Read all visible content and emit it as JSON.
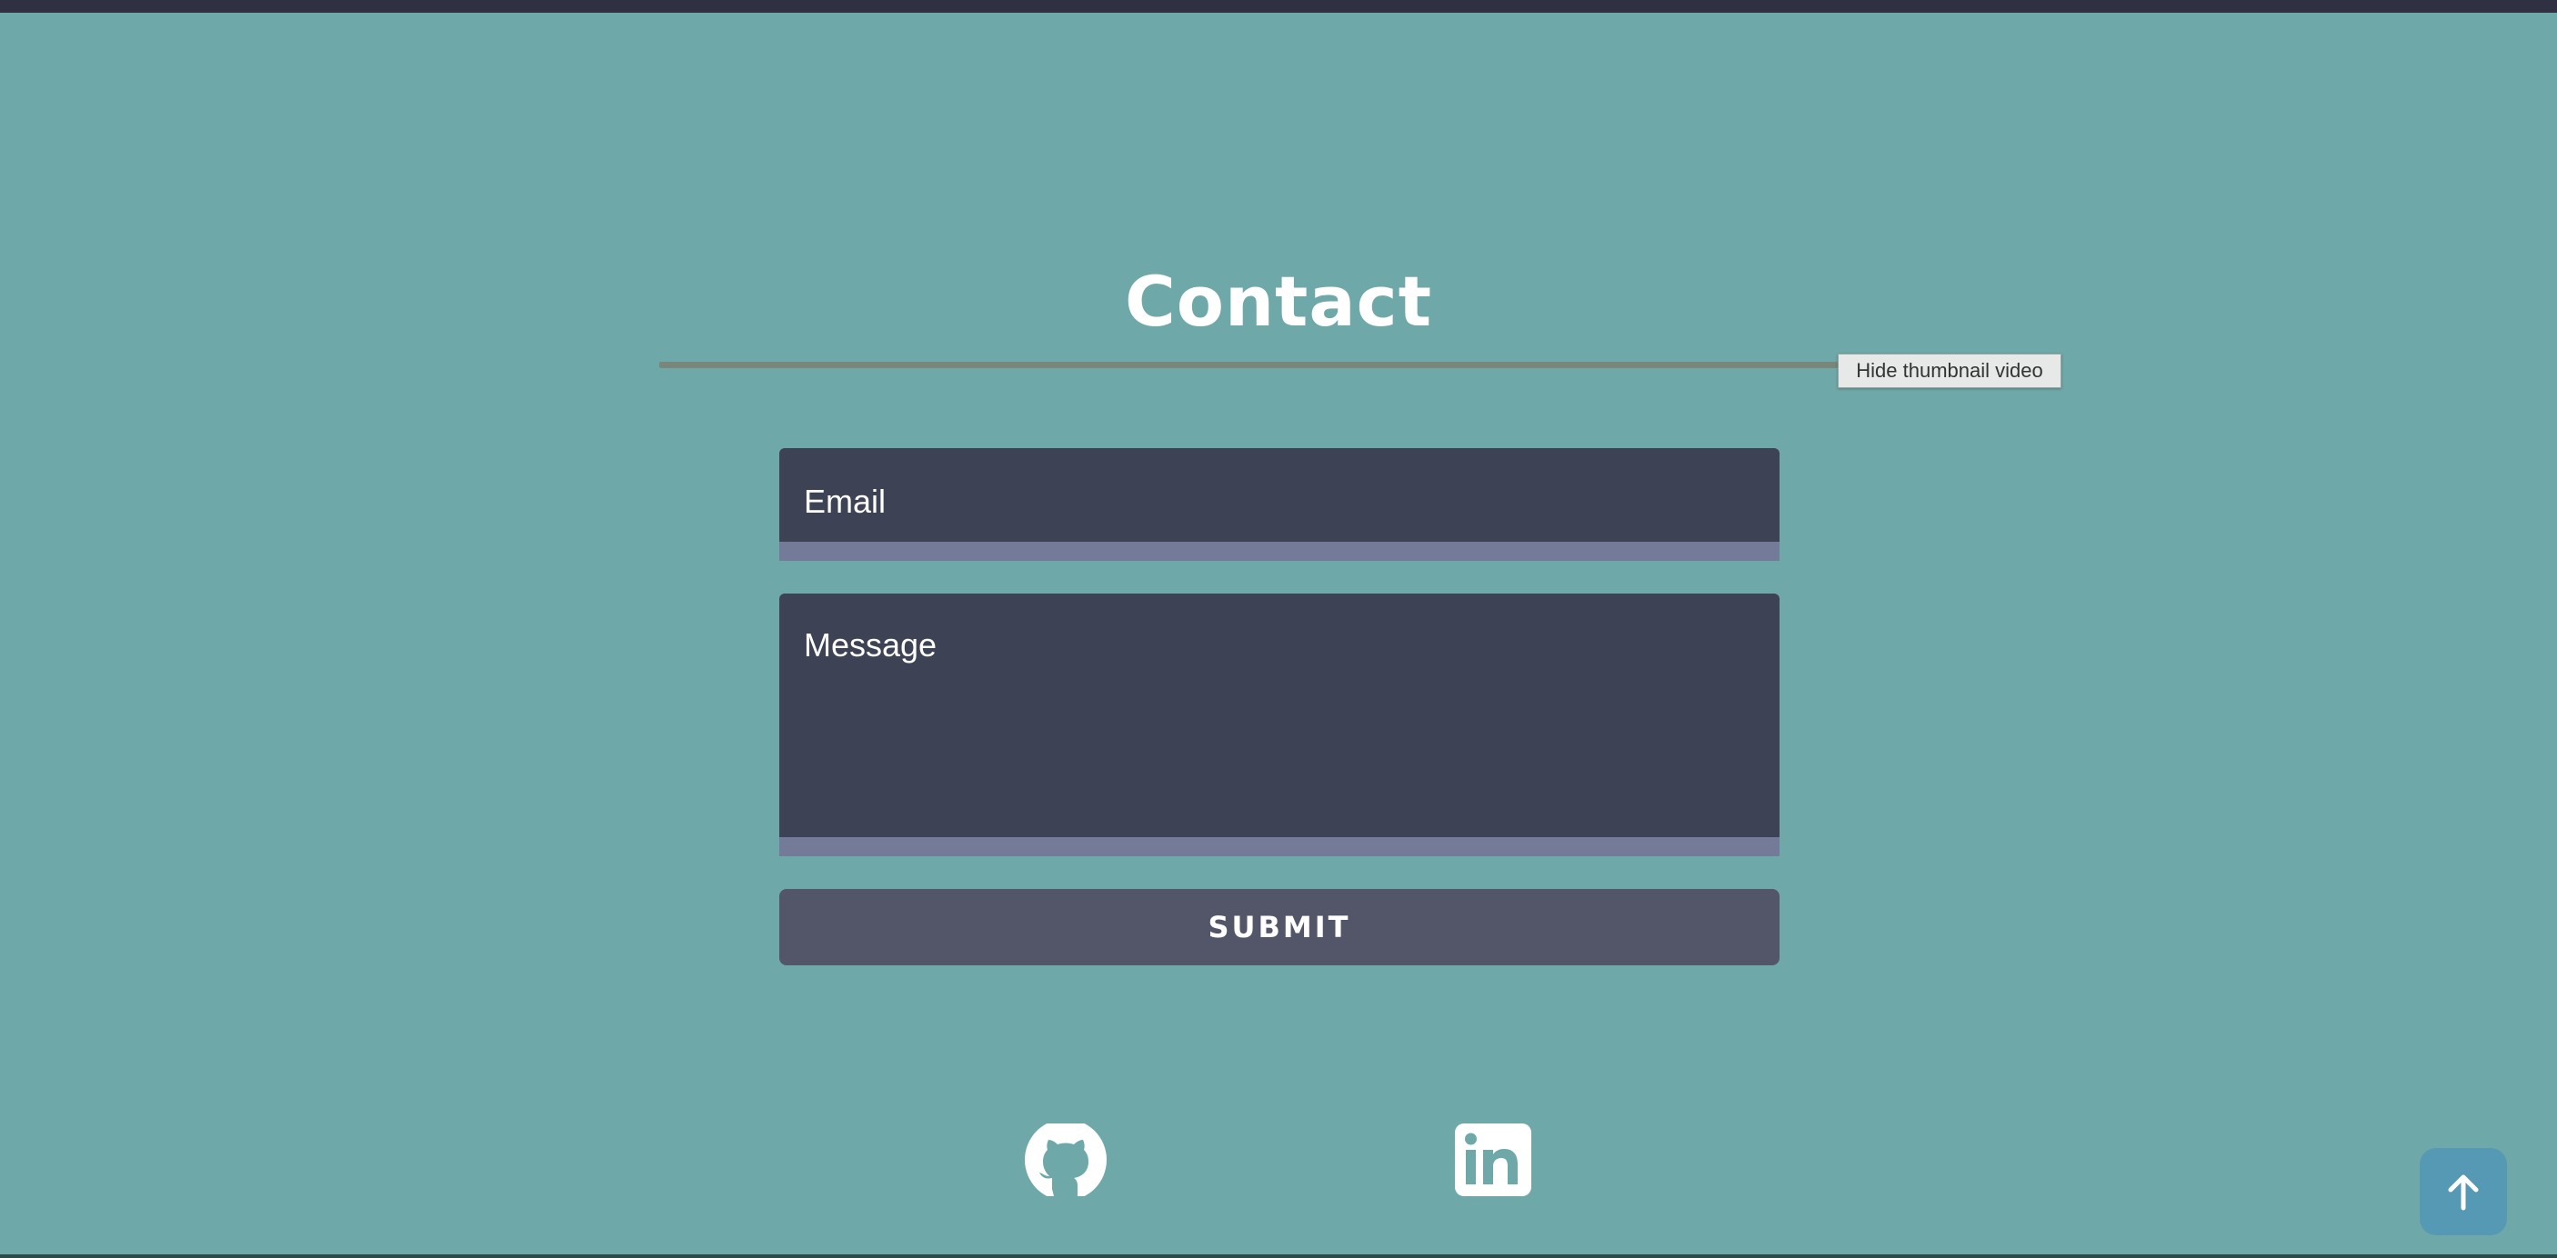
{
  "section": {
    "title": "Contact"
  },
  "tooltip": {
    "text": "Hide thumbnail video"
  },
  "form": {
    "email_placeholder": "Email",
    "message_placeholder": "Message",
    "submit_label": "SUBMIT"
  },
  "social": {
    "items": [
      {
        "name": "github",
        "icon": "github-icon"
      },
      {
        "name": "linkedin",
        "icon": "linkedin-icon"
      }
    ]
  },
  "scroll_top": {
    "icon": "arrow-up-icon"
  },
  "colors": {
    "background": "#6fa8a8",
    "field_background": "#3d4354",
    "field_underline": "#737b98",
    "button_background": "#535569",
    "scroll_button": "#5599b4",
    "divider": "#7a8679"
  }
}
